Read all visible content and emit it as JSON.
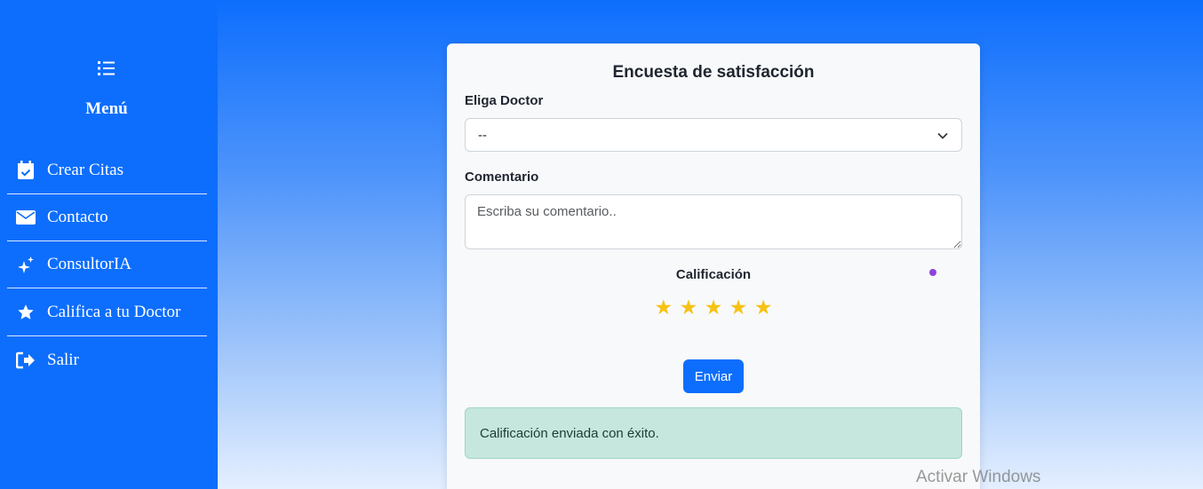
{
  "sidebar": {
    "menu_icon": "list-icon",
    "title": "Menú",
    "items": [
      {
        "label": "Crear Citas",
        "icon": "calendar-check-icon"
      },
      {
        "label": "Contacto",
        "icon": "envelope-icon"
      },
      {
        "label": "ConsultorIA",
        "icon": "sparkles-icon"
      },
      {
        "label": "Califica a tu Doctor",
        "icon": "star-icon"
      },
      {
        "label": "Salir",
        "icon": "sign-out-icon"
      }
    ]
  },
  "survey": {
    "title": "Encuesta de satisfacción",
    "doctor_label": "Eliga Doctor",
    "doctor_selected": "--",
    "comment_label": "Comentario",
    "comment_placeholder": "Escriba su comentario..",
    "rating_label": "Calificación",
    "rating_stars": 5,
    "submit_label": "Enviar",
    "success_message": "Calificación enviada con éxito."
  },
  "colors": {
    "primary": "#0d6efd",
    "star": "#f6c214",
    "success_bg": "#c5e7de"
  },
  "os_watermark": "Activar Windows"
}
